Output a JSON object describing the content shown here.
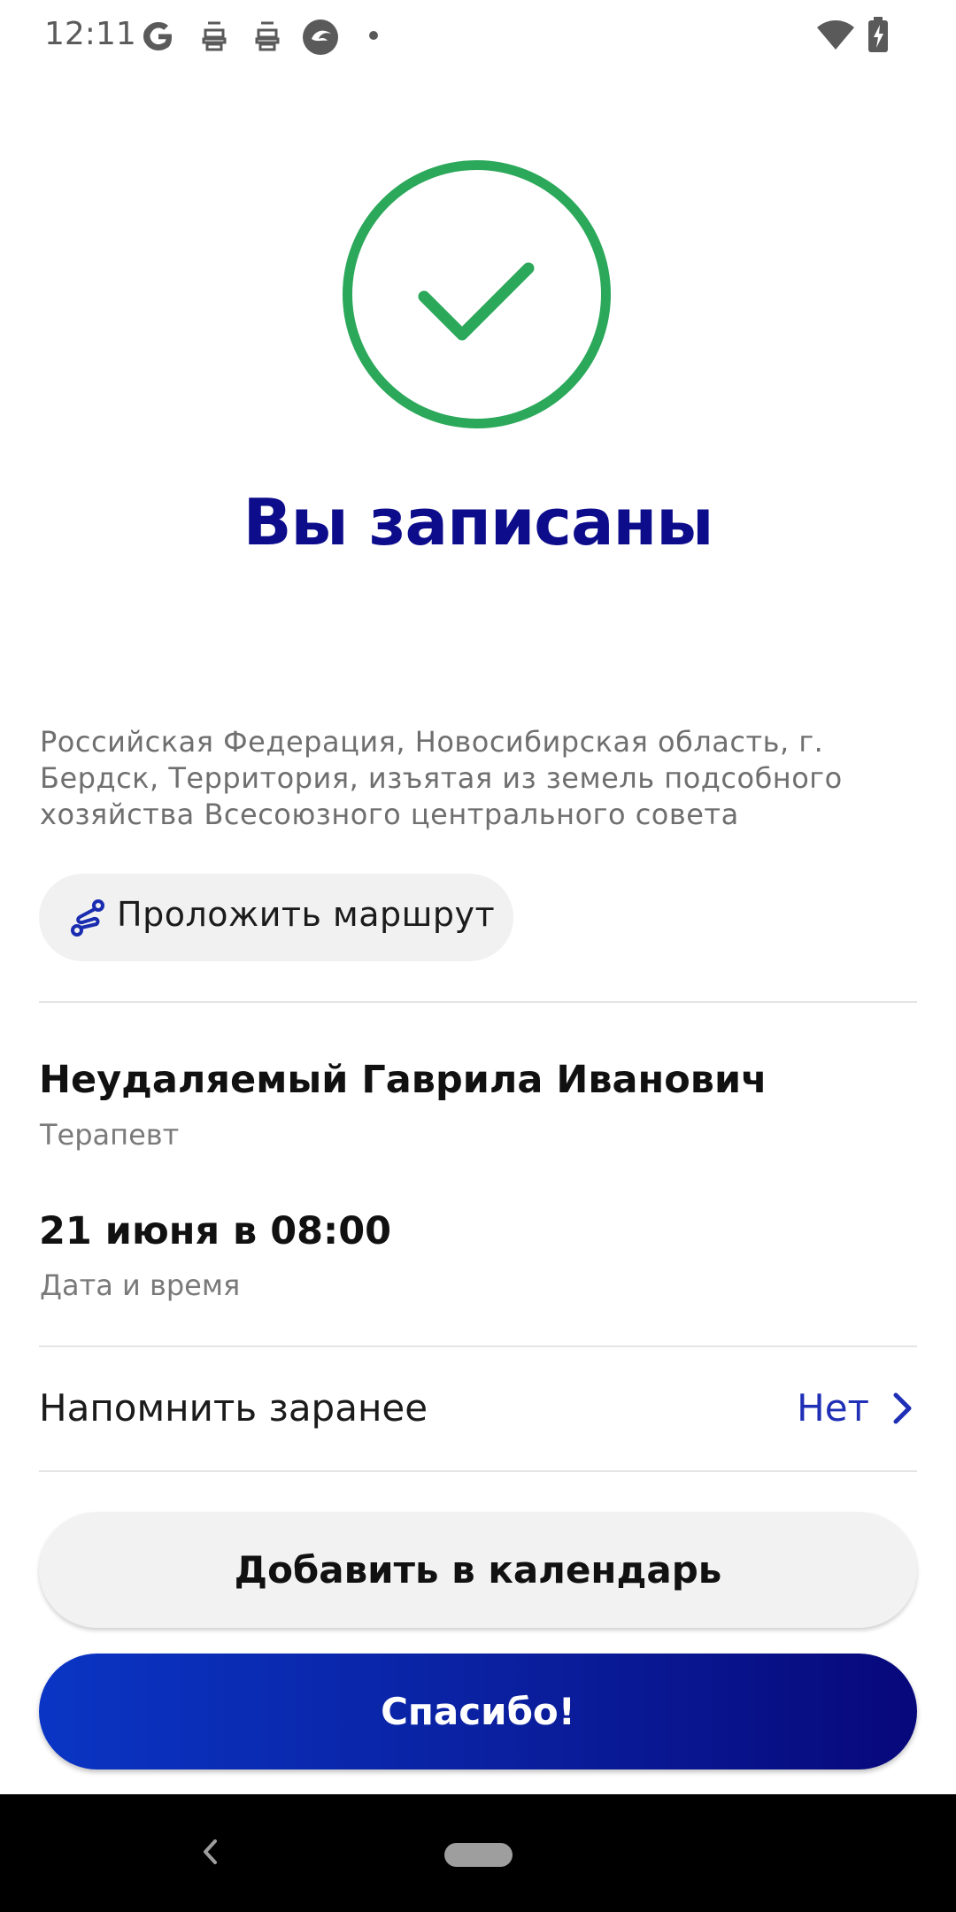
{
  "status_bar": {
    "time": "12:11",
    "icons": [
      "google-icon",
      "robot-icon",
      "robot-icon",
      "app-icon",
      "dot-icon",
      "wifi-icon",
      "battery-charging-icon"
    ]
  },
  "success": {
    "icon": "check-circle-icon",
    "icon_color": "#2ba85a",
    "title": "Вы записаны"
  },
  "address": "Российская Федерация, Новосибирская область, г. Бердск, Территория, изъятая из земель подсобного хозяйства Всесоюзного центрального совета",
  "route_button": {
    "icon": "route-icon",
    "label": "Проложить маршрут"
  },
  "doctor": {
    "name": "Неудаляемый Гаврила Иванович",
    "specialty": "Терапевт"
  },
  "appointment": {
    "datetime": "21 июня в 08:00",
    "label": "Дата и время"
  },
  "reminder": {
    "label": "Напомнить заранее",
    "value": "Нет",
    "icon": "chevron-right-icon"
  },
  "buttons": {
    "add_calendar": "Добавить в календарь",
    "thanks": "Спасибо!"
  },
  "nav_bar": {
    "back_icon": "back-icon",
    "home_icon": "home-pill-icon"
  },
  "colors": {
    "title": "#0d0d8c",
    "accent": "#1f2fb6",
    "success": "#2ba85a"
  }
}
